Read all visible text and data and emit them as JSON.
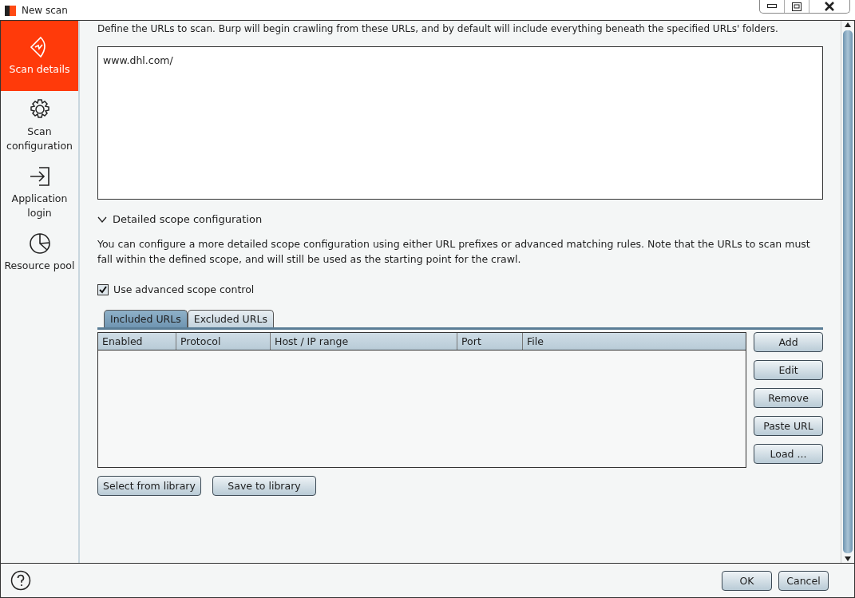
{
  "window": {
    "title": "New scan"
  },
  "sidebar": {
    "items": [
      {
        "kind": "details",
        "label": "Scan details",
        "selected": true
      },
      {
        "kind": "config",
        "label": "Scan configuration",
        "selected": false
      },
      {
        "kind": "login",
        "label": "Application login",
        "selected": false
      },
      {
        "kind": "pool",
        "label": "Resource pool",
        "selected": false
      }
    ]
  },
  "intro": "Define the URLs to scan. Burp will begin crawling from these URLs, and by default will include everything beneath the specified URLs' folders.",
  "urls_field": {
    "value": "www.dhl.com/"
  },
  "scope_section": {
    "title": "Detailed scope configuration",
    "expanded": true,
    "description": "You can configure a more detailed scope configuration using either URL prefixes or advanced matching rules. Note that the URLs to scan must fall within the defined scope, and will still be used as the starting point for the crawl.",
    "advanced_checkbox": {
      "label": "Use advanced scope control",
      "checked": true
    },
    "tabs": [
      {
        "label": "Included URLs",
        "selected": true
      },
      {
        "label": "Excluded URLs",
        "selected": false
      }
    ],
    "table": {
      "columns": [
        "Enabled",
        "Protocol",
        "Host / IP range",
        "Port",
        "File"
      ]
    },
    "side_buttons": [
      "Add",
      "Edit",
      "Remove",
      "Paste URL",
      "Load ..."
    ],
    "library_buttons": [
      "Select from library",
      "Save to library"
    ]
  },
  "footer": {
    "buttons": [
      "OK",
      "Cancel"
    ]
  }
}
